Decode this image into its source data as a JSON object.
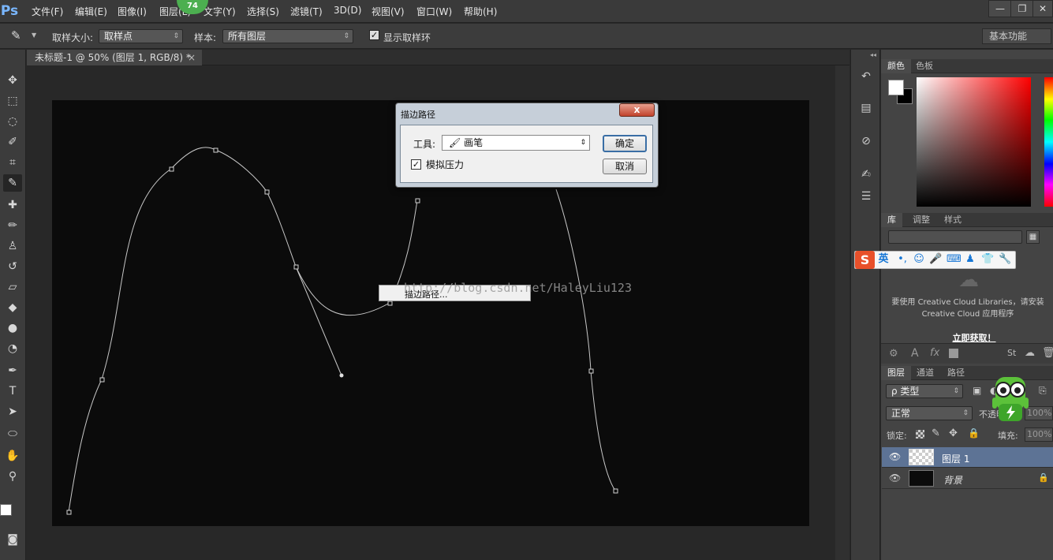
{
  "app": {
    "logo": "Ps",
    "badge": "74"
  },
  "menu": [
    "文件(F)",
    "编辑(E)",
    "图像(I)",
    "图层(L)",
    "文字(Y)",
    "选择(S)",
    "滤镜(T)",
    "3D(D)",
    "视图(V)",
    "窗口(W)",
    "帮助(H)"
  ],
  "window_controls": {
    "minimize": "—",
    "restore": "❐",
    "close": "✕"
  },
  "options": {
    "sample_size_label": "取样大小:",
    "sample_size_value": "取样点",
    "sample_label": "样本:",
    "sample_value": "所有图层",
    "show_ring_label": "显示取样环",
    "workspace": "基本功能"
  },
  "document": {
    "tab_title": "未标题-1 @ 50% (图层 1, RGB/8) *",
    "close": "×"
  },
  "panels": {
    "color_tabs": [
      "颜色",
      "色板"
    ],
    "lib_tabs": [
      "库",
      "调整",
      "样式"
    ],
    "cc_message": "要使用 Creative Cloud Libraries，请安装 Creative Cloud 应用程序",
    "cc_link": "立即获取！",
    "layer_tabs": [
      "图层",
      "通道",
      "路径"
    ],
    "kind_filter": "ρ 类型",
    "blend_mode": "正常",
    "opacity_label": "不透明度:",
    "opacity_value": "100%",
    "lock_label": "锁定:",
    "fill_label": "填充:",
    "fill_value": "100%",
    "layers": [
      {
        "name": "图层 1",
        "selected": true
      },
      {
        "name": "背景",
        "selected": false,
        "locked": true
      }
    ]
  },
  "sogou": {
    "logo": "S",
    "mode": "英"
  },
  "dialog": {
    "title": "描边路径",
    "close": "x",
    "tool_label": "工具:",
    "tool_value": "画笔",
    "simulate_pressure": "模拟压力",
    "ok": "确定",
    "cancel": "取消"
  },
  "context_menu": {
    "item": "描边路径..."
  },
  "watermark": "http://blog.csdn.net/HaleyLiu123",
  "colors": {
    "accent": "#5d7395",
    "canvas": "#0b0b0b",
    "badge": "#4caf50",
    "sogou": "#e8502a"
  }
}
